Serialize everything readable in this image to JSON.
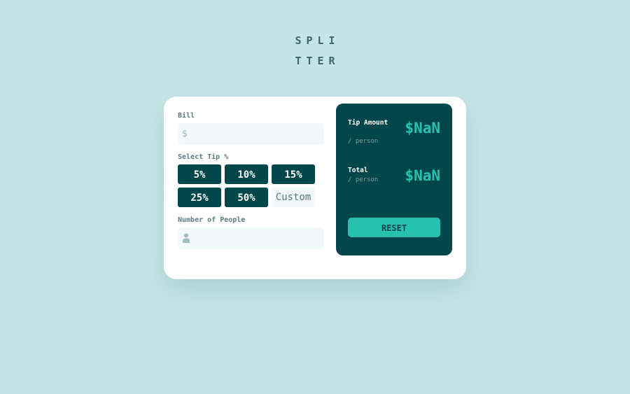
{
  "logo": {
    "line1": "SPLI",
    "line2": "TTER"
  },
  "bill": {
    "label": "Bill",
    "currency_symbol": "$",
    "value": "",
    "placeholder": ""
  },
  "tip": {
    "label": "Select Tip %",
    "options": [
      "5%",
      "10%",
      "15%",
      "25%",
      "50%"
    ],
    "custom_placeholder": "Custom"
  },
  "people": {
    "label": "Number of People",
    "value": "",
    "icon": "person-icon"
  },
  "results": {
    "tip_amount": {
      "title": "Tip Amount",
      "sub": "/ person",
      "value": "$NaN"
    },
    "total": {
      "title": "Total",
      "sub": "/ person",
      "value": "$NaN"
    },
    "reset_label": "RESET"
  },
  "colors": {
    "background": "#c5e4e7",
    "dark_teal": "#00474b",
    "accent": "#26c2ae",
    "input_bg": "#f3f9fa"
  }
}
